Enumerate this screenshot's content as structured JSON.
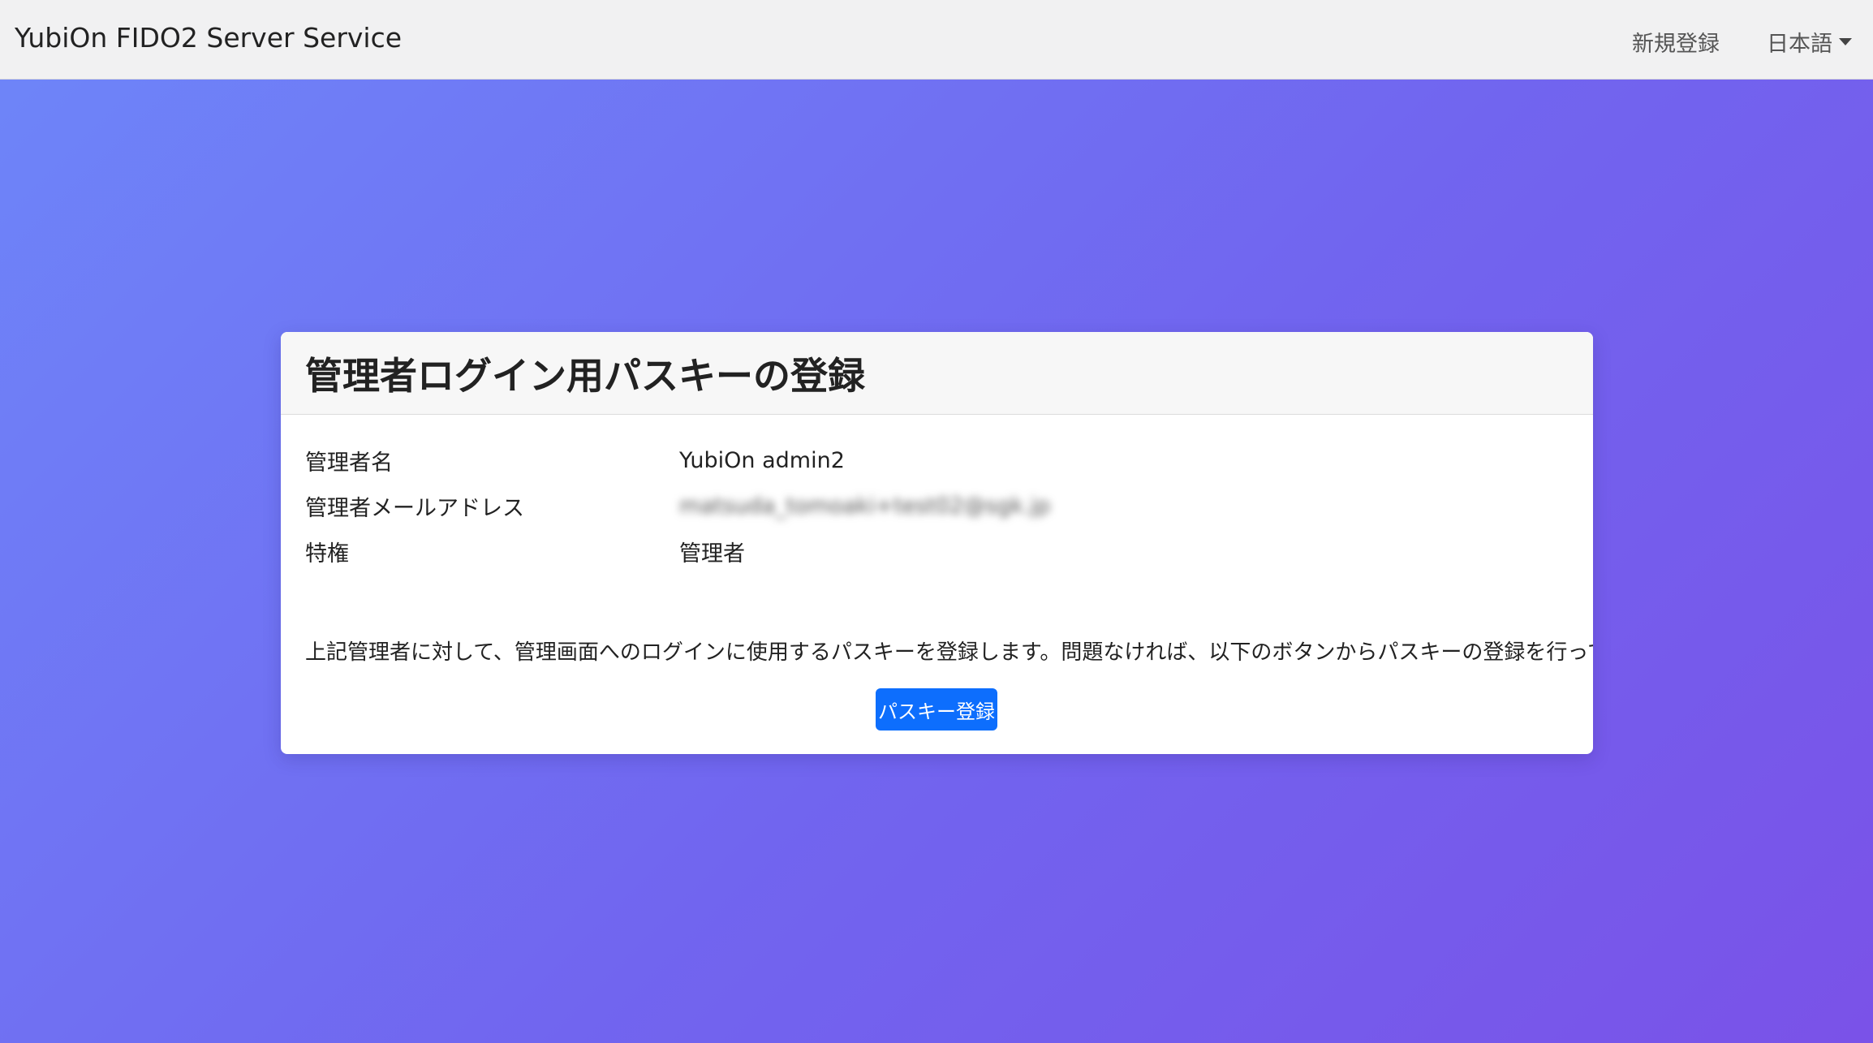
{
  "navbar": {
    "brand": "YubiOn FIDO2 Server Service",
    "signup_label": "新規登録",
    "language_label": "日本語"
  },
  "card": {
    "title": "管理者ログイン用パスキーの登録",
    "rows": [
      {
        "label": "管理者名",
        "value": "YubiOn admin2"
      },
      {
        "label": "管理者メールアドレス",
        "value": "matsuda_tomoaki+test02@sgk.jp"
      },
      {
        "label": "特権",
        "value": "管理者"
      }
    ],
    "message": "上記管理者に対して、管理画面へのログインに使用するパスキーを登録します。問題なければ、以下のボタンからパスキーの登録を行ってください。",
    "button_label": "パスキー登録"
  },
  "colors": {
    "background_start": "#6e86f9",
    "background_end": "#7a52e8",
    "primary_button": "#0d6efd",
    "navbar_bg": "#f1f1f2"
  }
}
